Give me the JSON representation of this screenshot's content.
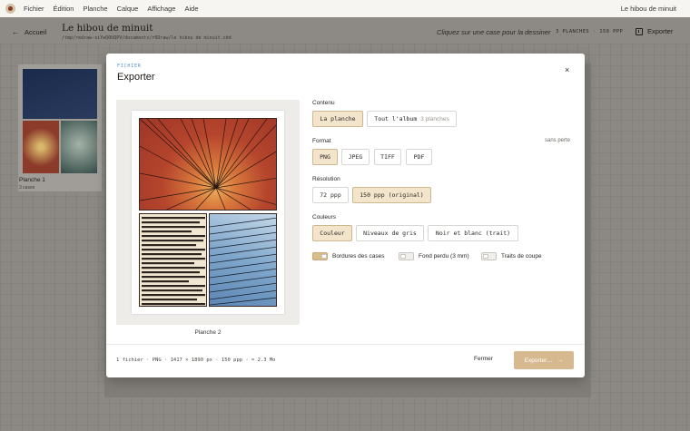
{
  "menubar": {
    "items": [
      "Fichier",
      "Édition",
      "Planche",
      "Calque",
      "Affichage",
      "Aide"
    ],
    "app_name": "Le hibou de minuit"
  },
  "header": {
    "back_label": "Accueil",
    "title": "Le hibou de minuit",
    "path": "/tmp/redraw-siYwQ0UQPV/documents/r6Draw/le hibou de minuit.cbd",
    "hint": "Cliquez sur une case pour la dessiner",
    "counts": "3 PLANCHES · 150 PPP",
    "export_label": "Exporter"
  },
  "sidebar": {
    "thumb_label": "Planche 1",
    "thumb_sub": "3 cases"
  },
  "modal": {
    "eyebrow": "FICHIER",
    "title": "Exporter",
    "close": "×",
    "preview_label": "Planche 2",
    "content": {
      "title": "Contenu",
      "options": [
        {
          "label": "La planche",
          "selected": true
        },
        {
          "label": "Tout l'album",
          "extra": "3 planches",
          "selected": false
        }
      ]
    },
    "format": {
      "title": "Format",
      "note": "sans perte",
      "options": [
        {
          "label": "PNG",
          "selected": true
        },
        {
          "label": "JPEG",
          "selected": false
        },
        {
          "label": "TIFF",
          "selected": false
        },
        {
          "label": "PDF",
          "selected": false
        }
      ]
    },
    "resolution": {
      "title": "Résolution",
      "options": [
        {
          "label": "72 ppp",
          "selected": false
        },
        {
          "label": "150 ppp (original)",
          "selected": true
        }
      ]
    },
    "colors": {
      "title": "Couleurs",
      "options": [
        {
          "label": "Couleur",
          "selected": true
        },
        {
          "label": "Niveaux de gris",
          "selected": false
        },
        {
          "label": "Noir et blanc (trait)",
          "selected": false
        }
      ]
    },
    "toggles": [
      {
        "label": "Bordures des cases",
        "on": true
      },
      {
        "label": "Fond perdu (3 mm)",
        "on": false
      },
      {
        "label": "Traits de coupe",
        "on": false
      }
    ],
    "summary": "1 fichier · PNG · 1417 × 1890 px · 150 ppp · ≈ 2.3 Mo",
    "close_button": "Fermer",
    "export_button": "Exporter…",
    "colors_palette": {
      "accent": "#d6b98f",
      "selected_bg": "#f2e5cc",
      "eyebrow": "#4f8fc9"
    }
  }
}
